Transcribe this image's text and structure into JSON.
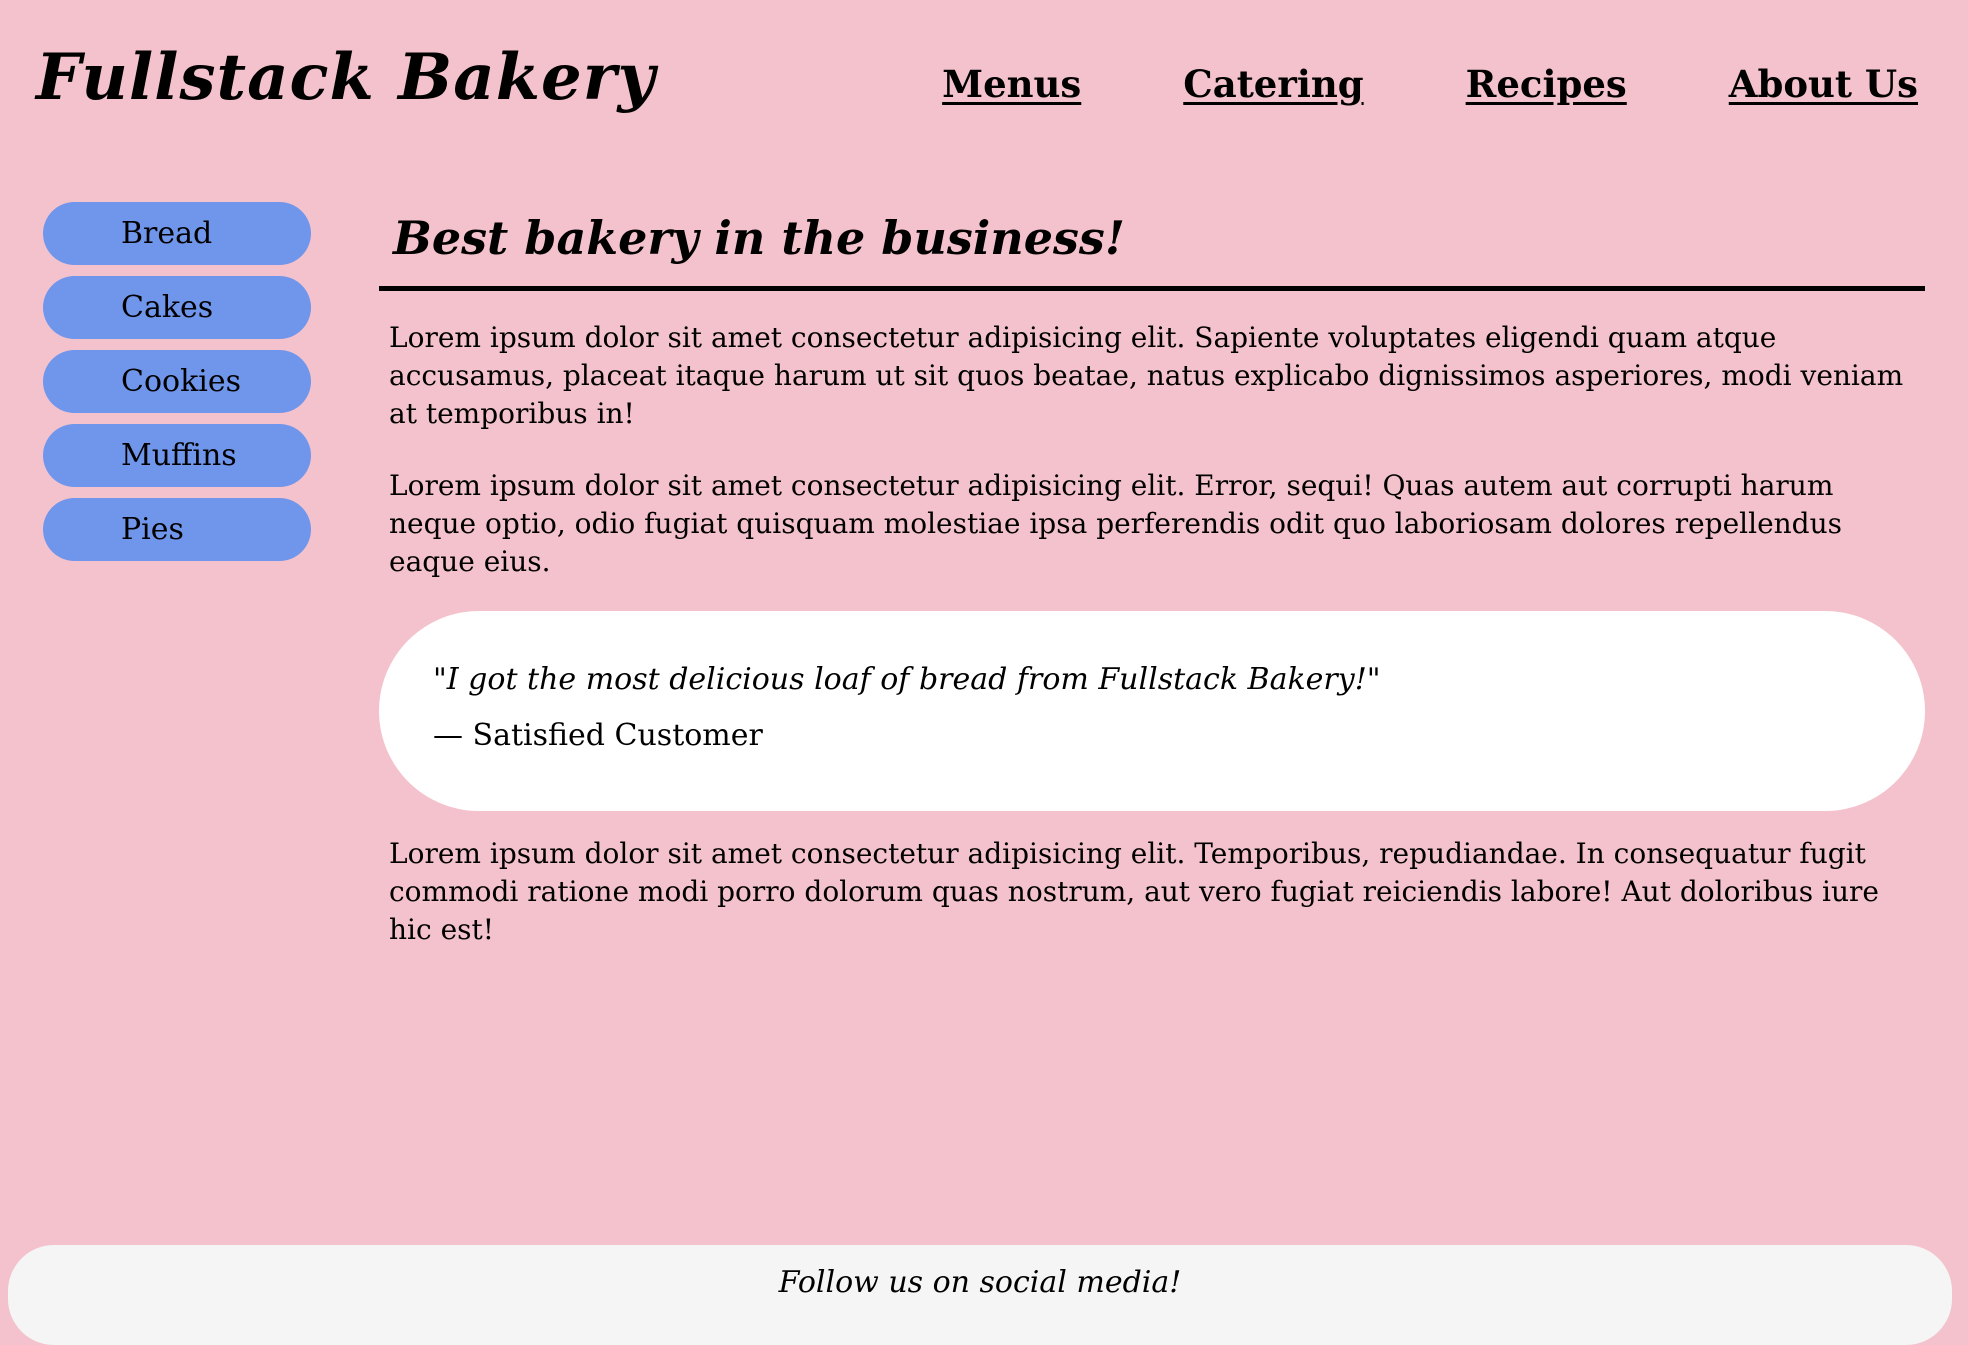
{
  "brand": {
    "title": "Fullstack Bakery"
  },
  "topnav": {
    "items": [
      {
        "label": "Menus"
      },
      {
        "label": "Catering"
      },
      {
        "label": "Recipes"
      },
      {
        "label": "About Us"
      }
    ]
  },
  "sidebar": {
    "items": [
      {
        "label": "Bread"
      },
      {
        "label": "Cakes"
      },
      {
        "label": "Cookies"
      },
      {
        "label": "Muffins"
      },
      {
        "label": "Pies"
      }
    ]
  },
  "main": {
    "heading": "Best bakery in the business!",
    "paragraphs": [
      "Lorem ipsum dolor sit amet consectetur adipisicing elit. Sapiente voluptates eligendi quam atque accusamus, placeat itaque harum ut sit quos beatae, natus explicabo dignissimos asperiores, modi veniam at temporibus in!",
      "Lorem ipsum dolor sit amet consectetur adipisicing elit. Error, sequi! Quas autem aut corrupti harum neque optio, odio fugiat quisquam molestiae ipsa perferendis odit quo laboriosam dolores repellendus eaque eius.",
      "Lorem ipsum dolor sit amet consectetur adipisicing elit. Temporibus, repudiandae. In consequatur fugit commodi ratione modi porro dolorum quas nostrum, aut vero fugiat reiciendis labore! Aut doloribus iure hic est!"
    ],
    "quote": {
      "text": "\"I got the most delicious loaf of bread from Fullstack Bakery!\"",
      "attribution": "— Satisfied Customer"
    }
  },
  "footer": {
    "text": "Follow us on social media!"
  },
  "colors": {
    "page_background": "#f4c2cc",
    "sidebar_button": "#7096ec",
    "quote_background": "#ffffff",
    "footer_background": "#f5f5f5"
  }
}
